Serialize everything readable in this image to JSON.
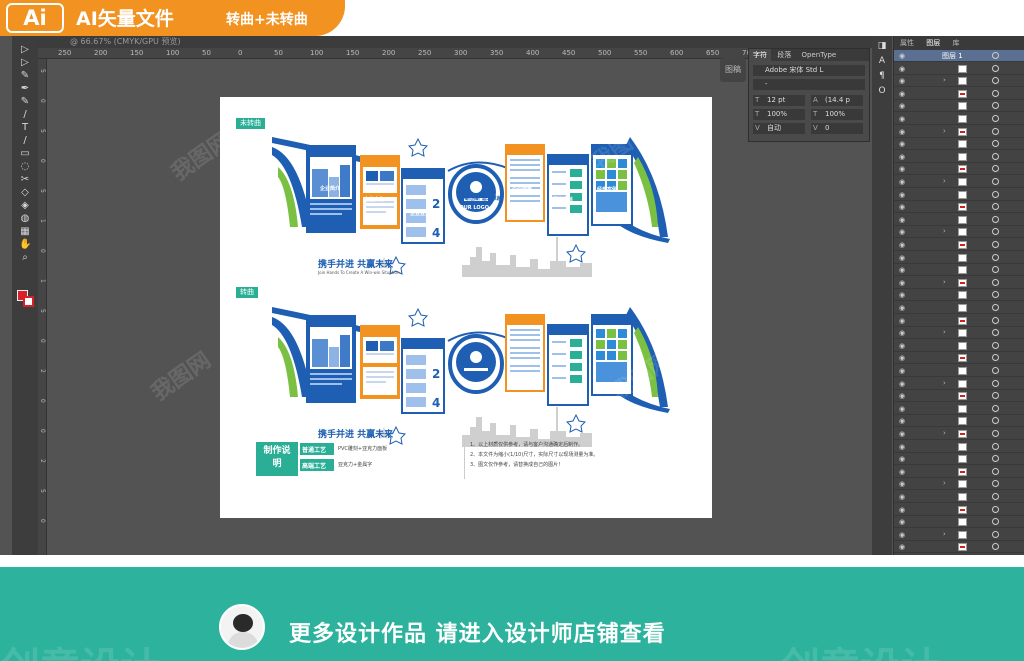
{
  "banner": {
    "logo": "Ai",
    "title": "AI矢量文件",
    "subtitle": "转曲+未转曲"
  },
  "tab": {
    "label": "@ 66.67% (CMYK/GPU 预览)"
  },
  "ruler": {
    "top": [
      "250",
      "200",
      "150",
      "100",
      "50",
      "0",
      "50",
      "100",
      "150",
      "200",
      "250",
      "300",
      "350",
      "400",
      "450",
      "500",
      "550",
      "600",
      "650",
      "700",
      "750",
      "800",
      "850"
    ],
    "left": [
      "5",
      "0",
      "5",
      "0",
      "5",
      "1",
      "0",
      "1",
      "5",
      "0",
      "2",
      "0",
      "0",
      "2",
      "5",
      "0"
    ]
  },
  "tools": [
    "▷",
    "▷",
    "✎",
    "✒",
    "✎",
    "/",
    "T",
    "/",
    "▭",
    "◌",
    "✂",
    "◇",
    "◈",
    "◍",
    "▦",
    "✋",
    "⌕"
  ],
  "character_panel": {
    "tabs": [
      "字符",
      "段落",
      "OpenType"
    ],
    "font": "Adobe 宋体 Std L",
    "style": "-",
    "size": "12 pt",
    "leading": "(14.4 p",
    "vscale": "100%",
    "hscale": "100%",
    "kerning": "自动",
    "tracking": "0"
  },
  "mini_dock": "图稿",
  "right_dock_icons": [
    "◨",
    "A",
    "¶",
    "O"
  ],
  "layers_panel": {
    "tabs": [
      "属性",
      "图层",
      "库"
    ],
    "top_layer": "图层 1"
  },
  "artboard": {
    "tag_uncurved": "未转曲",
    "tag_curved": "转曲",
    "slogan": "携手并进  共赢未来",
    "slogan_en": "Join Hands To Create A Win-win Situation",
    "tagline": "不断创新  追求卓越",
    "logo_text": "YOUR LOGO",
    "panels": [
      "企业简介",
      "企业文化",
      "企业业务",
      "企业荣誉",
      "服务项目",
      "经典案例"
    ],
    "subtitle_card": "创新成就未来",
    "nums": [
      "1",
      "2",
      "3",
      "4"
    ],
    "notes": {
      "title": "制作说明",
      "item1": "普通工艺",
      "item2": "高端工艺",
      "text1": "PVC雕刻+亚克力面板",
      "text2": "亚克力+金属字",
      "list": [
        "1、以上材质仅供参考，请与客户沟通确定后制作。",
        "2、本文件为缩小(1/10)尺寸，实际尺寸以现场测量为准。",
        "3、图文仅作参考，请替换成自己的图片！"
      ]
    }
  },
  "watermark": "我图网",
  "bottom": {
    "text": "更多设计作品 请进入设计师店铺查看",
    "ghost": "创意设计"
  },
  "colors": {
    "orange": "#f29221",
    "teal": "#2db39d",
    "blue": "#1e5fb3",
    "green": "#7ac143"
  }
}
